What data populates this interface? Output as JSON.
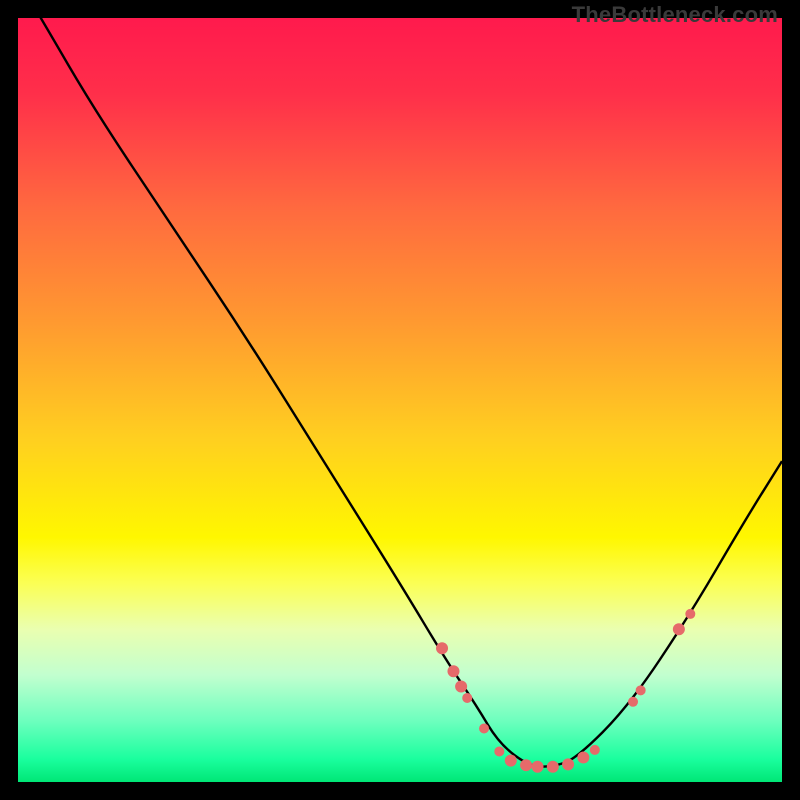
{
  "watermark": "TheBottleneck.com",
  "chart_data": {
    "type": "line",
    "title": "",
    "xlabel": "",
    "ylabel": "",
    "xlim": [
      0,
      100
    ],
    "ylim": [
      0,
      100
    ],
    "series": [
      {
        "name": "bottleneck-curve",
        "x": [
          0,
          3,
          10,
          20,
          30,
          40,
          50,
          56,
          60,
          63,
          67,
          70,
          73,
          80,
          88,
          95,
          100
        ],
        "y": [
          105,
          100,
          88,
          73,
          58,
          42,
          26,
          16,
          10,
          5,
          2,
          2,
          3,
          10,
          22,
          34,
          42
        ]
      }
    ],
    "markers": {
      "name": "highlighted-points",
      "color": "#e66a6a",
      "points": [
        {
          "x": 55.5,
          "y": 17.5,
          "r": 6
        },
        {
          "x": 57.0,
          "y": 14.5,
          "r": 6
        },
        {
          "x": 58.0,
          "y": 12.5,
          "r": 6
        },
        {
          "x": 58.8,
          "y": 11.0,
          "r": 5
        },
        {
          "x": 61.0,
          "y": 7.0,
          "r": 5
        },
        {
          "x": 63.0,
          "y": 4.0,
          "r": 5
        },
        {
          "x": 64.5,
          "y": 2.8,
          "r": 6
        },
        {
          "x": 66.5,
          "y": 2.2,
          "r": 6
        },
        {
          "x": 68.0,
          "y": 2.0,
          "r": 6
        },
        {
          "x": 70.0,
          "y": 2.0,
          "r": 6
        },
        {
          "x": 72.0,
          "y": 2.3,
          "r": 6
        },
        {
          "x": 74.0,
          "y": 3.2,
          "r": 6
        },
        {
          "x": 75.5,
          "y": 4.2,
          "r": 5
        },
        {
          "x": 80.5,
          "y": 10.5,
          "r": 5
        },
        {
          "x": 81.5,
          "y": 12.0,
          "r": 5
        },
        {
          "x": 86.5,
          "y": 20.0,
          "r": 6
        },
        {
          "x": 88.0,
          "y": 22.0,
          "r": 5
        }
      ]
    },
    "gradient_stops": [
      {
        "offset": 0.0,
        "color": "#ff1a4d"
      },
      {
        "offset": 0.1,
        "color": "#ff2f4a"
      },
      {
        "offset": 0.25,
        "color": "#ff6a3f"
      },
      {
        "offset": 0.4,
        "color": "#ff9a30"
      },
      {
        "offset": 0.55,
        "color": "#ffcf20"
      },
      {
        "offset": 0.68,
        "color": "#fff700"
      },
      {
        "offset": 0.74,
        "color": "#fbff55"
      },
      {
        "offset": 0.8,
        "color": "#eaffb0"
      },
      {
        "offset": 0.86,
        "color": "#c2ffcf"
      },
      {
        "offset": 0.92,
        "color": "#6dffbe"
      },
      {
        "offset": 0.97,
        "color": "#1aff9e"
      },
      {
        "offset": 1.0,
        "color": "#00e676"
      }
    ]
  }
}
